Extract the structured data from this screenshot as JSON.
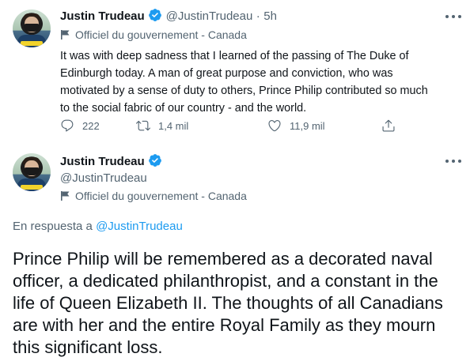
{
  "tweet1": {
    "author_name": "Justin Trudeau",
    "handle": "@JustinTrudeau",
    "separator": "·",
    "time": "5h",
    "gov_label": "Officiel du gouvernement - Canada",
    "text": "It was with deep sadness that I learned of the passing of The Duke of Edinburgh today. A man of great purpose and conviction, who was motivated by a sense of duty to others, Prince Philip contributed so much to the social fabric of our country - and the world.",
    "reply_count": "222",
    "retweet_count": "1,4 mil",
    "like_count": "11,9 mil"
  },
  "tweet2": {
    "author_name": "Justin Trudeau",
    "handle": "@JustinTrudeau",
    "gov_label": "Officiel du gouvernement - Canada",
    "reply_prefix": "En respuesta a",
    "reply_handle": "@JustinTrudeau",
    "text": "Prince Philip will be remembered as a decorated naval officer, a dedicated philanthropist, and a constant in the life of Queen Elizabeth II. The thoughts of all Canadians are with her and the entire Royal Family as they mourn this significant loss."
  },
  "icons": {
    "verified": "verified-badge-icon",
    "flag": "government-flag-icon",
    "more": "more-horizontal-icon",
    "reply": "reply-icon",
    "retweet": "retweet-icon",
    "like": "like-icon",
    "share": "share-icon"
  },
  "colors": {
    "text": "#0f1419",
    "secondary": "#536471",
    "link": "#1d9bf0",
    "verified": "#1d9bf0"
  }
}
